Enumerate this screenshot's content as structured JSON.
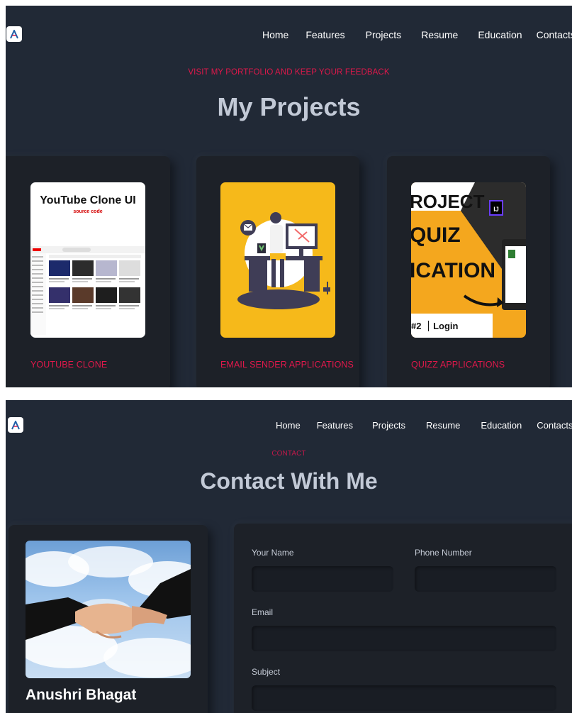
{
  "logo": {
    "letter": "A",
    "icon": "logo-a-icon"
  },
  "nav": [
    "Home",
    "Features",
    "Projects",
    "Resume",
    "Education",
    "Contacts"
  ],
  "projects_section": {
    "kicker": "VISIT MY PORTFOLIO AND KEEP YOUR FEEDBACK",
    "title": "My Projects",
    "cards": [
      {
        "title": "YOUTUBE CLONE",
        "thumb": {
          "headline": "YouTube Clone UI",
          "sub": "source code"
        }
      },
      {
        "title": "EMAIL SENDER APPLICATIONS",
        "thumb": {
          "icon": "email-developer-illustration"
        }
      },
      {
        "title": "QUIZZ APPLICATIONS",
        "thumb": {
          "line1": "ROJECT",
          "line2": "QUIZ",
          "line3": "ICATION",
          "badge": "IJ",
          "step": "#2",
          "step_label": "Login"
        }
      }
    ]
  },
  "contact_section": {
    "kicker": "CONTACT",
    "title": "Contact With Me",
    "profile": {
      "name": "Anushri Bhagat",
      "image": "handshake-photo"
    },
    "form": {
      "name_label": "Your Name",
      "phone_label": "Phone Number",
      "email_label": "Email",
      "subject_label": "Subject"
    }
  },
  "colors": {
    "background": "#212936",
    "card": "#1d2128",
    "accent": "#e0184b",
    "heading": "#c2c9d6"
  }
}
